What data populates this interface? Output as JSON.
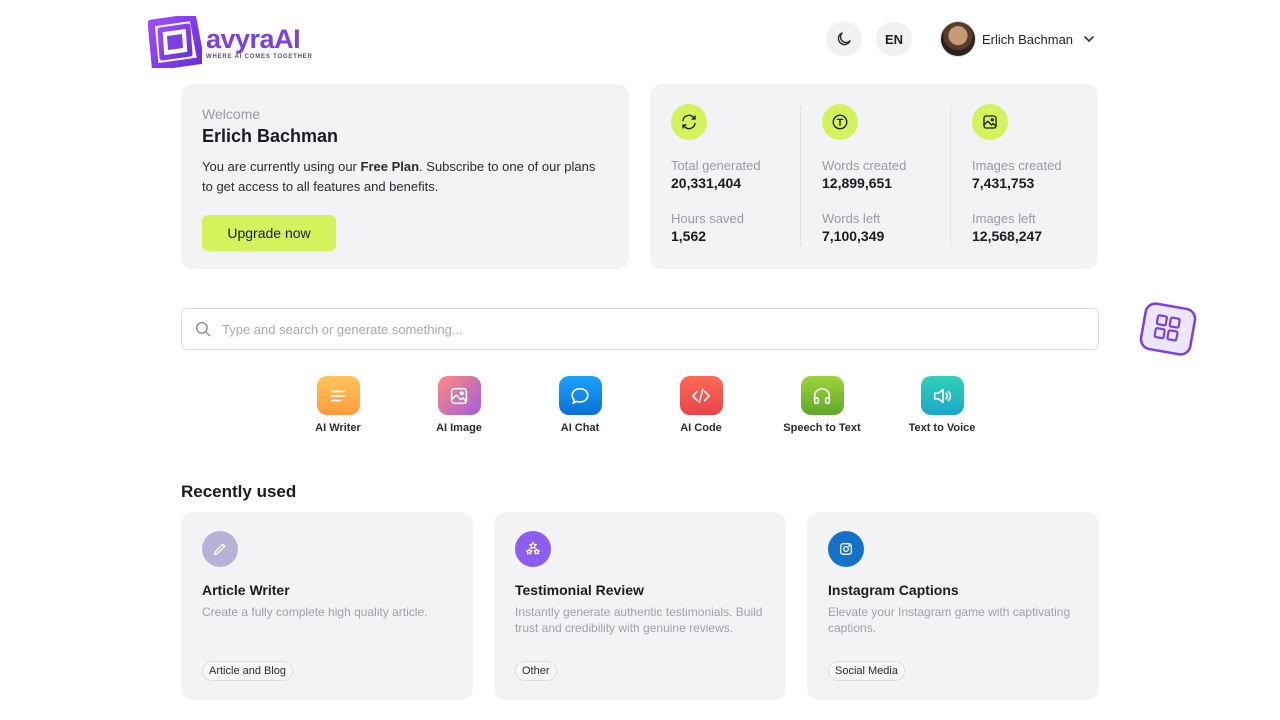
{
  "brand": {
    "name": "avyraAI",
    "tagline": "WHERE AI COMES TOGETHER",
    "accent": "#7b3fe4"
  },
  "header": {
    "theme_icon": "moon-icon",
    "language": "EN",
    "user_name": "Erlich Bachman"
  },
  "welcome": {
    "label": "Welcome",
    "name": "Erlich Bachman",
    "text_before": "You are currently using our ",
    "plan": "Free Plan",
    "text_after": ". Subscribe to one of our plans to get access to all features and benefits.",
    "upgrade_label": "Upgrade now"
  },
  "stats": [
    {
      "icon": "refresh-icon",
      "label1": "Total generated",
      "value1": "20,331,404",
      "label2": "Hours saved",
      "value2": "1,562"
    },
    {
      "icon": "text-icon",
      "label1": "Words created",
      "value1": "12,899,651",
      "label2": "Words left",
      "value2": "7,100,349"
    },
    {
      "icon": "image-icon",
      "label1": "Images created",
      "value1": "7,431,753",
      "label2": "Images left",
      "value2": "12,568,247"
    }
  ],
  "search": {
    "placeholder": "Type and search or generate something..."
  },
  "tools": [
    {
      "label": "AI Writer",
      "icon": "lines-icon"
    },
    {
      "label": "AI Image",
      "icon": "image-icon"
    },
    {
      "label": "AI Chat",
      "icon": "chat-bubble-icon"
    },
    {
      "label": "AI Code",
      "icon": "code-icon"
    },
    {
      "label": "Speech to Text",
      "icon": "headphones-icon"
    },
    {
      "label": "Text to Voice",
      "icon": "speaker-icon"
    }
  ],
  "recent": {
    "title": "Recently used",
    "items": [
      {
        "title": "Article Writer",
        "desc": "Create a fully complete high quality article.",
        "tag": "Article and Blog",
        "icon": "pencil-icon"
      },
      {
        "title": "Testimonial Review",
        "desc": "Instantly generate authentic testimonials. Build trust and credibility with genuine reviews.",
        "tag": "Other",
        "icon": "stars-icon"
      },
      {
        "title": "Instagram Captions",
        "desc": "Elevate your Instagram game with captivating captions.",
        "tag": "Social Media",
        "icon": "instagram-icon"
      }
    ]
  }
}
